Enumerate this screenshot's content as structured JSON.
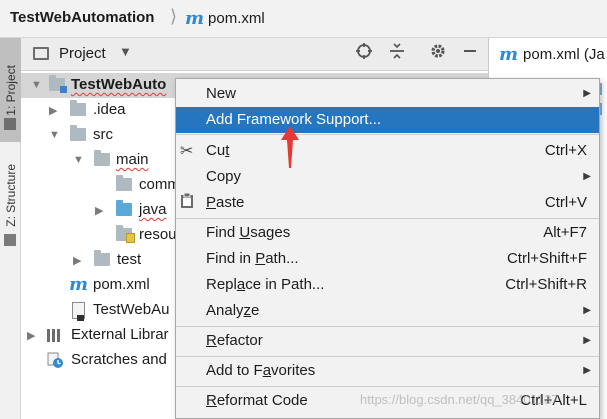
{
  "breadcrumb": {
    "project": "TestWebAutomation",
    "separator": "⟩",
    "file_icon": "m",
    "file": "pom.xml"
  },
  "tool_stripe": {
    "project_tab": "1: Project",
    "structure_tab": "Z: Structure"
  },
  "project_panel": {
    "title": "Project",
    "caret": "▼",
    "icons": [
      "target-icon",
      "collapse-icon",
      "gear-icon",
      "minimize-icon"
    ]
  },
  "editor": {
    "tab_icon": "m",
    "tab_label": "pom.xml (Ja"
  },
  "tree": [
    {
      "label": "TestWebAuto",
      "bold": true,
      "squiggle": true,
      "arrow": "▼",
      "icon": "module-folder"
    },
    {
      "label": ".idea",
      "arrow": "▶",
      "icon": "folder"
    },
    {
      "label": "src",
      "arrow": "▼",
      "icon": "folder"
    },
    {
      "label": "main",
      "arrow": "▼",
      "icon": "folder",
      "squiggle": true
    },
    {
      "label": "comm",
      "icon": "folder"
    },
    {
      "label": "java",
      "arrow": "▶",
      "icon": "blue-folder",
      "squiggle": true
    },
    {
      "label": "resou",
      "icon": "resources-folder"
    },
    {
      "label": "test",
      "arrow": "▶",
      "icon": "folder"
    },
    {
      "label": "pom.xml",
      "icon": "maven"
    },
    {
      "label": "TestWebAu",
      "icon": "iml-file"
    },
    {
      "label": "External Librar",
      "arrow": "▶",
      "icon": "library"
    },
    {
      "label": "Scratches and",
      "icon": "scratches"
    }
  ],
  "menu": {
    "items": [
      {
        "label": "New",
        "shortcut": "",
        "submenu": true
      },
      {
        "label": "Add Framework Support...",
        "shortcut": "",
        "highlighted": true
      },
      {
        "label": "Cut",
        "shortcut": "Ctrl+X",
        "icon": "✂"
      },
      {
        "label": "Copy",
        "shortcut": "",
        "submenu": true
      },
      {
        "label": "Paste",
        "shortcut": "Ctrl+V",
        "icon": "📋"
      },
      {
        "label": "Find Usages",
        "shortcut": "Alt+F7"
      },
      {
        "label": "Find in Path...",
        "shortcut": "Ctrl+Shift+F"
      },
      {
        "label": "Replace in Path...",
        "shortcut": "Ctrl+Shift+R"
      },
      {
        "label": "Analyze",
        "shortcut": "",
        "submenu": true
      },
      {
        "label": "Refactor",
        "shortcut": "",
        "submenu": true
      },
      {
        "label": "Add to Favorites",
        "shortcut": "",
        "submenu": true
      },
      {
        "label": "Reformat Code",
        "shortcut": "Ctrl+Alt+L"
      }
    ]
  },
  "watermark": "https://blog.csdn.net/qq_38401137",
  "colors": {
    "highlight": "#2675bf",
    "cursor_arrow": "#e53935",
    "maven_icon": "#2f8ad6"
  }
}
